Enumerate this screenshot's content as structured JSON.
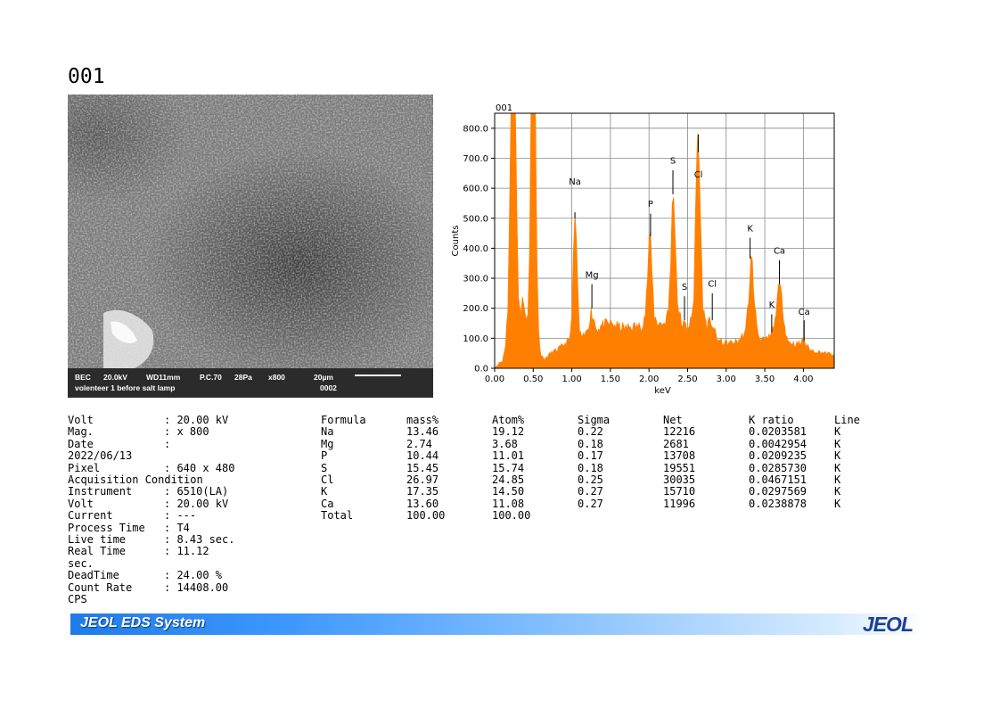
{
  "page": {
    "title": "001"
  },
  "sem": {
    "labels": [
      "BEC",
      "20.0kV",
      "WD11mm",
      "P.C.70",
      "28Pa",
      "x800",
      "20µm"
    ],
    "caption": "volenteer 1 before salt lamp",
    "number": "0002"
  },
  "chart_data": {
    "type": "area",
    "title": "001",
    "xlabel": "keV",
    "ylabel": "Counts",
    "xlim": [
      0.0,
      4.4
    ],
    "ylim": [
      0.0,
      850.0
    ],
    "xticks": [
      "0.00",
      "0.50",
      "1.00",
      "1.50",
      "2.00",
      "2.50",
      "3.00",
      "3.50",
      "4.00"
    ],
    "yticks": [
      "0.0",
      "100.0",
      "200.0",
      "300.0",
      "400.0",
      "500.0",
      "600.0",
      "700.0",
      "800.0"
    ],
    "color": "#ff8000",
    "grid": true,
    "spectrum": [
      [
        0.0,
        0
      ],
      [
        0.06,
        18
      ],
      [
        0.1,
        22
      ],
      [
        0.14,
        80
      ],
      [
        0.17,
        200
      ],
      [
        0.19,
        500
      ],
      [
        0.21,
        850
      ],
      [
        0.27,
        850
      ],
      [
        0.29,
        500
      ],
      [
        0.31,
        220
      ],
      [
        0.34,
        200
      ],
      [
        0.36,
        250
      ],
      [
        0.38,
        200
      ],
      [
        0.41,
        160
      ],
      [
        0.43,
        180
      ],
      [
        0.45,
        380
      ],
      [
        0.47,
        850
      ],
      [
        0.53,
        850
      ],
      [
        0.55,
        350
      ],
      [
        0.57,
        120
      ],
      [
        0.6,
        45
      ],
      [
        0.65,
        30
      ],
      [
        0.7,
        45
      ],
      [
        0.75,
        55
      ],
      [
        0.8,
        60
      ],
      [
        0.85,
        70
      ],
      [
        0.9,
        80
      ],
      [
        0.95,
        90
      ],
      [
        0.98,
        110
      ],
      [
        1.0,
        200
      ],
      [
        1.02,
        380
      ],
      [
        1.04,
        500
      ],
      [
        1.06,
        430
      ],
      [
        1.08,
        250
      ],
      [
        1.1,
        120
      ],
      [
        1.14,
        100
      ],
      [
        1.18,
        115
      ],
      [
        1.22,
        150
      ],
      [
        1.25,
        190
      ],
      [
        1.28,
        170
      ],
      [
        1.32,
        130
      ],
      [
        1.4,
        145
      ],
      [
        1.5,
        150
      ],
      [
        1.6,
        140
      ],
      [
        1.7,
        135
      ],
      [
        1.8,
        140
      ],
      [
        1.9,
        140
      ],
      [
        1.95,
        180
      ],
      [
        1.98,
        300
      ],
      [
        2.0,
        420
      ],
      [
        2.02,
        440
      ],
      [
        2.04,
        320
      ],
      [
        2.07,
        170
      ],
      [
        2.12,
        150
      ],
      [
        2.2,
        150
      ],
      [
        2.25,
        190
      ],
      [
        2.28,
        350
      ],
      [
        2.3,
        540
      ],
      [
        2.32,
        575
      ],
      [
        2.34,
        450
      ],
      [
        2.37,
        220
      ],
      [
        2.42,
        150
      ],
      [
        2.5,
        140
      ],
      [
        2.55,
        160
      ],
      [
        2.58,
        230
      ],
      [
        2.6,
        500
      ],
      [
        2.62,
        720
      ],
      [
        2.63,
        770
      ],
      [
        2.65,
        700
      ],
      [
        2.67,
        470
      ],
      [
        2.7,
        200
      ],
      [
        2.75,
        140
      ],
      [
        2.8,
        160
      ],
      [
        2.83,
        140
      ],
      [
        2.88,
        100
      ],
      [
        2.95,
        85
      ],
      [
        3.05,
        85
      ],
      [
        3.15,
        90
      ],
      [
        3.25,
        120
      ],
      [
        3.29,
        230
      ],
      [
        3.32,
        365
      ],
      [
        3.34,
        350
      ],
      [
        3.37,
        200
      ],
      [
        3.42,
        110
      ],
      [
        3.5,
        90
      ],
      [
        3.58,
        110
      ],
      [
        3.63,
        150
      ],
      [
        3.66,
        240
      ],
      [
        3.69,
        275
      ],
      [
        3.72,
        240
      ],
      [
        3.76,
        140
      ],
      [
        3.8,
        90
      ],
      [
        3.9,
        80
      ],
      [
        3.97,
        85
      ],
      [
        4.0,
        100
      ],
      [
        4.03,
        80
      ],
      [
        4.1,
        60
      ],
      [
        4.2,
        55
      ],
      [
        4.3,
        50
      ],
      [
        4.4,
        45
      ]
    ],
    "peaks": [
      {
        "label": "Na",
        "x": 1.04,
        "label_y": 612,
        "top": 520,
        "bottom": 500
      },
      {
        "label": "Mg",
        "x": 1.26,
        "label_y": 302,
        "top": 280,
        "bottom": 200
      },
      {
        "label": "P",
        "x": 2.02,
        "label_y": 538,
        "top": 515,
        "bottom": 440
      },
      {
        "label": "S",
        "x": 2.31,
        "label_y": 682,
        "top": 660,
        "bottom": 580
      },
      {
        "label": "Cl",
        "x": 2.64,
        "label_y": 636,
        "top": 720,
        "bottom": 780
      },
      {
        "label": "S",
        "x": 2.46,
        "label_y": 262,
        "top": 240,
        "bottom": 160
      },
      {
        "label": "Cl",
        "x": 2.82,
        "label_y": 272,
        "top": 250,
        "bottom": 160
      },
      {
        "label": "K",
        "x": 3.31,
        "label_y": 456,
        "top": 435,
        "bottom": 365
      },
      {
        "label": "Ca",
        "x": 3.69,
        "label_y": 382,
        "top": 360,
        "bottom": 280
      },
      {
        "label": "K",
        "x": 3.59,
        "label_y": 202,
        "top": 180,
        "bottom": 120
      },
      {
        "label": "Ca",
        "x": 4.01,
        "label_y": 178,
        "top": 160,
        "bottom": 90
      }
    ]
  },
  "params": [
    {
      "key": "Volt",
      "value": ": 20.00 kV"
    },
    {
      "key": "Mag.",
      "value": ": x 800"
    },
    {
      "key": "Date",
      "value": ":",
      "wrap": "2022/06/13"
    },
    {
      "key": "Pixel",
      "value": ": 640 x 480"
    },
    {
      "key": "Acquisition Condition",
      "value": ""
    },
    {
      "key": "Instrument",
      "value": ": 6510(LA)"
    },
    {
      "key": "Volt",
      "value": ": 20.00 kV"
    },
    {
      "key": "Current",
      "value": ": ---"
    },
    {
      "key": "Process Time",
      "value": ": T4"
    },
    {
      "key": "Live time",
      "value": ": 8.43 sec."
    },
    {
      "key": "Real Time",
      "value": ": 11.12",
      "wrap": "sec."
    },
    {
      "key": "DeadTime",
      "value": ": 24.00 %"
    },
    {
      "key": "Count Rate",
      "value": ": 14408.00",
      "wrap": "CPS"
    }
  ],
  "results": {
    "headers": [
      "Formula",
      "mass%",
      "Atom%",
      "Sigma",
      "Net",
      "K ratio",
      "Line"
    ],
    "rows": [
      [
        "Na",
        "13.46",
        "19.12",
        "0.22",
        "12216",
        "0.0203581",
        "K"
      ],
      [
        "Mg",
        "2.74",
        "3.68",
        "0.18",
        "2681",
        "0.0042954",
        "K"
      ],
      [
        "P",
        "10.44",
        "11.01",
        "0.17",
        "13708",
        "0.0209235",
        "K"
      ],
      [
        "S",
        "15.45",
        "15.74",
        "0.18",
        "19551",
        "0.0285730",
        "K"
      ],
      [
        "Cl",
        "26.97",
        "24.85",
        "0.25",
        "30035",
        "0.0467151",
        "K"
      ],
      [
        "K",
        "17.35",
        "14.50",
        "0.27",
        "15710",
        "0.0297569",
        "K"
      ],
      [
        "Ca",
        "13.60",
        "11.08",
        "0.27",
        "11996",
        "0.0238878",
        "K"
      ]
    ],
    "total": [
      "Total",
      "100.00",
      "100.00"
    ]
  },
  "footer": {
    "system": "JEOL EDS System",
    "logo": "JEOL"
  }
}
